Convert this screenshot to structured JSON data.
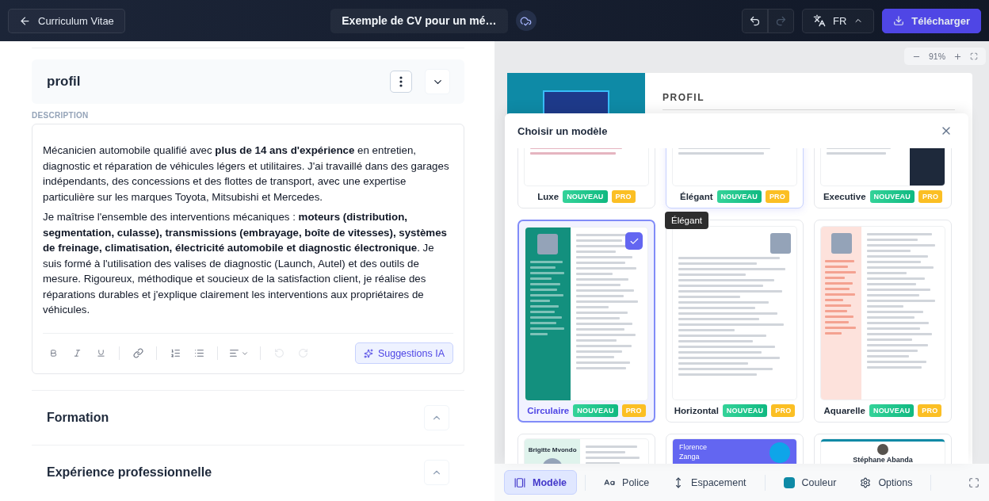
{
  "header": {
    "back_label": "Curriculum Vitae",
    "document_title": "Exemple de CV pour un mé…",
    "redo_disabled": true,
    "language": "FR",
    "download_label": "Télécharger"
  },
  "editor": {
    "section_title": "profil",
    "description_label": "DESCRIPTION",
    "paragraphs": [
      "Mécanicien automobile qualifié avec **plus de 14 ans d'expérience** en entretien, diagnostic et réparation de véhicules légers et utilitaires. J'ai travaillé dans des garages indépendants, des concessions et des flottes de transport, avec une expertise particulière sur les marques Toyota, Mitsubishi et Mercedes.",
      "Je maîtrise l'ensemble des interventions mécaniques : **moteurs (distribution, segmentation, culasse), transmissions (embrayage, boîte de vitesses), systèmes de freinage, climatisation, électricité automobile et diagnostic électronique**. Je suis formé à l'utilisation des valises de diagnostic (Launch, Autel) et des outils de mesure. Rigoureux, méthodique et soucieux de la satisfaction client, je réalise des réparations durables et j'explique clairement les interventions aux propriétaires de véhicules."
    ],
    "ai_button": "Suggestions IA",
    "collapsed_sections": [
      "Formation",
      "Expérience professionnelle"
    ]
  },
  "preview": {
    "zoom": "91%",
    "heading": "PROFIL"
  },
  "template_picker": {
    "title": "Choisir un modèle",
    "tooltip": "Élégant",
    "templates": [
      {
        "name": "Luxe",
        "kind": "luxe",
        "selected": false,
        "hovered": false,
        "badges": [
          {
            "label": "NOUVEAU",
            "kind": "new"
          },
          {
            "label": "PRO",
            "kind": "pro"
          }
        ]
      },
      {
        "name": "Élégant",
        "kind": "elegant",
        "selected": false,
        "hovered": true,
        "badges": [
          {
            "label": "NOUVEAU",
            "kind": "new"
          },
          {
            "label": "PRO",
            "kind": "pro"
          }
        ]
      },
      {
        "name": "Executive",
        "kind": "executive",
        "selected": false,
        "hovered": false,
        "badges": [
          {
            "label": "NOUVEAU",
            "kind": "new"
          },
          {
            "label": "PRO",
            "kind": "pro"
          }
        ]
      },
      {
        "name": "Circulaire",
        "kind": "circular",
        "selected": true,
        "hovered": false,
        "badges": [
          {
            "label": "NOUVEAU",
            "kind": "new"
          },
          {
            "label": "PRO",
            "kind": "pro"
          }
        ]
      },
      {
        "name": "Horizontal",
        "kind": "horizontal",
        "selected": false,
        "hovered": false,
        "badges": [
          {
            "label": "NOUVEAU",
            "kind": "new"
          },
          {
            "label": "PRO",
            "kind": "pro"
          }
        ]
      },
      {
        "name": "Aquarelle",
        "kind": "watercolor",
        "selected": false,
        "hovered": false,
        "badges": [
          {
            "label": "NOUVEAU",
            "kind": "new"
          },
          {
            "label": "PRO",
            "kind": "pro"
          }
        ]
      }
    ],
    "partial_templates": [
      {
        "kind": "mint",
        "preview_name": "Brigitte Mvondo"
      },
      {
        "kind": "banner",
        "preview_name": "Florence Zanga"
      },
      {
        "kind": "centered",
        "preview_name": "Stéphane Abanda"
      }
    ]
  },
  "bottom_toolbar": {
    "tabs": [
      {
        "label": "Modèle",
        "kind": "template",
        "selected": true
      },
      {
        "label": "Police",
        "kind": "font",
        "selected": false
      },
      {
        "label": "Espacement",
        "kind": "spacing",
        "selected": false
      },
      {
        "label": "Couleur",
        "kind": "color",
        "selected": false,
        "color": "#0e8aa6"
      },
      {
        "label": "Options",
        "kind": "options",
        "selected": false
      }
    ]
  }
}
